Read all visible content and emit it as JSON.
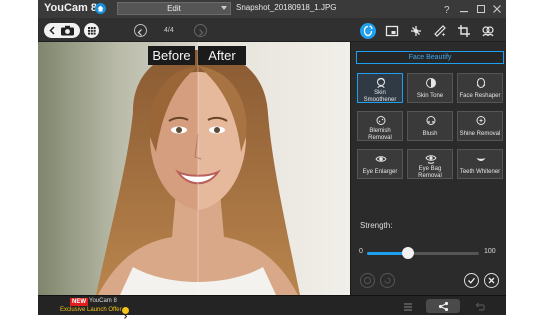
{
  "app": {
    "title": "YouCam 8",
    "filename": "Snapshot_20180918_1.JPG"
  },
  "mode_select": {
    "value": "Edit"
  },
  "toolbar": {
    "page_indicator": "4/4",
    "tools": [
      "face-beautify-icon",
      "frame-icon",
      "effects-icon",
      "crop-icon",
      "enhance-icon",
      "dual-face-icon"
    ],
    "active_tool": "face-beautify-icon"
  },
  "photo": {
    "before_label": "Before",
    "after_label": "After"
  },
  "panel": {
    "title": "Face Beautify",
    "features": [
      {
        "label": "Skin Smoothener",
        "icon": "skin-smoothener-icon",
        "selected": true
      },
      {
        "label": "Skin Tone",
        "icon": "skin-tone-icon",
        "selected": false
      },
      {
        "label": "Face Reshaper",
        "icon": "face-reshaper-icon",
        "selected": false
      },
      {
        "label": "Blemish Removal",
        "icon": "blemish-removal-icon",
        "selected": false
      },
      {
        "label": "Blush",
        "icon": "blush-icon",
        "selected": false
      },
      {
        "label": "Shine Removal",
        "icon": "shine-removal-icon",
        "selected": false
      },
      {
        "label": "Eye Enlarger",
        "icon": "eye-enlarger-icon",
        "selected": false
      },
      {
        "label": "Eye Bag Removal",
        "icon": "eye-bag-removal-icon",
        "selected": false
      },
      {
        "label": "Teeth Whitener",
        "icon": "teeth-whitener-icon",
        "selected": false
      }
    ],
    "strength": {
      "label": "Strength:",
      "min": "0",
      "max": "100",
      "value": 37
    }
  },
  "bottom": {
    "new_badge": "NEW",
    "promo_title": "YouCam 8",
    "promo_offer": "Exclusive Launch Offer"
  },
  "colors": {
    "accent": "#1f9ff0",
    "panel_bg": "#2b2b2b",
    "promo": "#f5c518",
    "new_badge": "#e01e1e"
  }
}
